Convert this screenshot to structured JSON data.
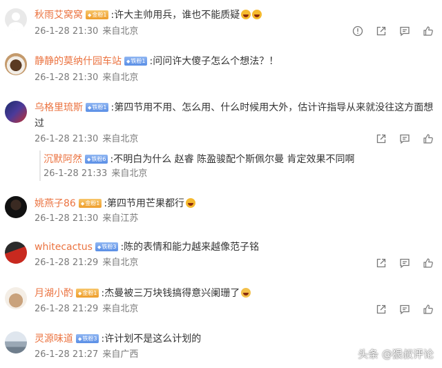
{
  "comments": [
    {
      "username": "秋雨艾窝窝",
      "badge": "金粉1",
      "text": ":许大主帅用兵，谁也不能质疑",
      "time": "26-1-28 21:30",
      "location": "来自北京",
      "avatar": "default-avatar-icon"
    },
    {
      "username": "静静的莫纳什园车站",
      "badge": "铁粉1",
      "text": ":问问许大傻子怎么个想法？！",
      "time": "26-1-28 21:30",
      "location": "来自北京",
      "avatar": "coffee-avatar"
    },
    {
      "username": "乌格里琉斯",
      "badge": "铁粉1",
      "text_line1": ":第四节用不用、怎么用、什么时候用大外，估计许指导从来就没往这方面想",
      "text_line2": "过",
      "time": "26-1-28 21:30",
      "location": "来自北京",
      "avatar": "team-avatar"
    },
    {
      "username": "沉默阿然",
      "badge": "铁粉6",
      "text": ":不明白为什么 赵睿 陈盈骏配个斯佩尔曼 肯定效果不同啊",
      "time": "26-1-28 21:33",
      "location": "来自北京",
      "is_reply": true
    },
    {
      "username": "姚燕子86",
      "badge": "金粉1",
      "text": ":第四节用芒果都行",
      "time": "26-1-28 21:30",
      "location": "来自江苏",
      "avatar": "person-avatar"
    },
    {
      "username": "whitecactus",
      "badge": "铁粉3",
      "text": ":陈的表情和能力越来越像范子铭",
      "time": "26-1-28 21:29",
      "location": "来自北京",
      "avatar": "player-avatar"
    },
    {
      "username": "月湖小酌",
      "badge": "金粉1",
      "text": ":杰曼被三万块钱搞得意兴阑珊了",
      "time": "26-1-28 21:29",
      "location": "来自北京",
      "avatar": "cup-avatar"
    },
    {
      "username": "灵源味道",
      "badge": "铁粉3",
      "text": ":许计划不是这么计划的",
      "time": "26-1-28 21:27",
      "location": "来自广西",
      "avatar": "landscape-avatar"
    }
  ],
  "watermark": "头条 @狠叔评论",
  "colors": {
    "username": "#eb7340",
    "meta": "#7a7a7a",
    "text": "#333333"
  }
}
